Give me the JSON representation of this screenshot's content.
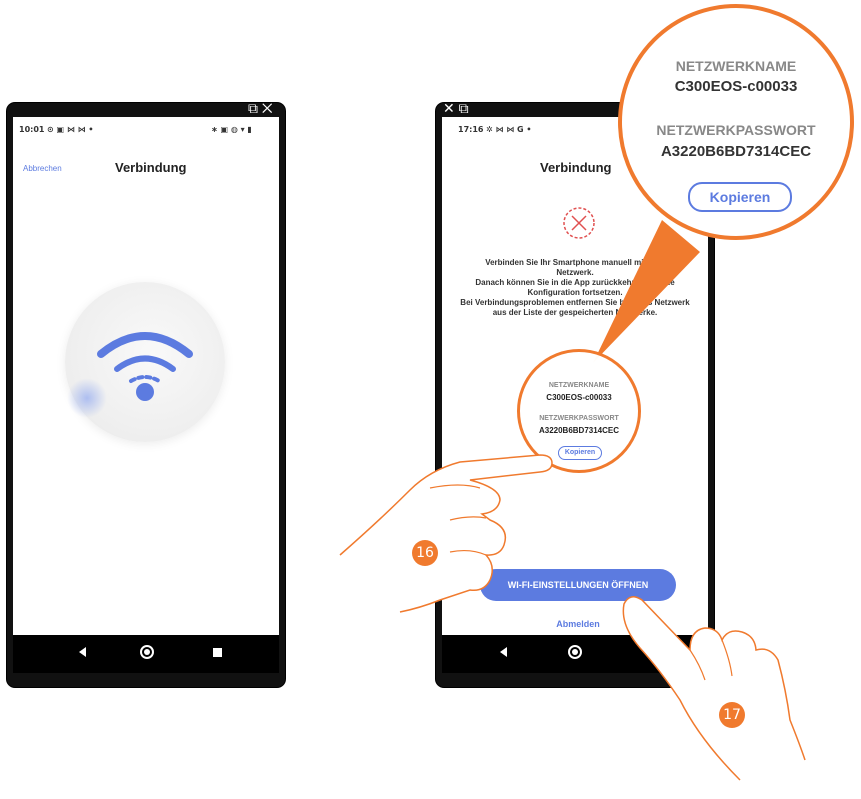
{
  "phone1": {
    "time": "10:01",
    "status_icons_left": "⊙ ▣ ⋈ ⋈ •",
    "status_icons_right": "∗ ▣ ◍ ▾ ▮",
    "top_icons": "⧉ ✕",
    "cancel_label": "Abbrechen",
    "title": "Verbindung"
  },
  "phone2": {
    "top_icons": "✕ ⧉",
    "time": "17:16",
    "status_icons_left": "✲ ⋈ ⋈ G •",
    "title": "Verbindung",
    "message_lines": [
      "Verbinden Sie Ihr Smartphone manuell mit dem",
      "Netzwerk.",
      "Danach können Sie in die App zurückkehren und die",
      "Konfiguration fortsetzen.",
      "Bei Verbindungsproblemen entfernen Sie bitte das Netzwerk",
      "aus der Liste der gespeicherten Netzwerke."
    ],
    "network_name_label": "NETZWERKNAME",
    "network_name": "C300EOS-c00033",
    "password_label": "NETZWERKPASSWORT",
    "password": "A3220B6BD7314CEC",
    "copy_label": "Kopieren",
    "wifi_settings_button": "WI-FI-EINSTELLUNGEN ÖFFNEN",
    "logout_label": "Abmelden"
  },
  "zoom": {
    "network_name_label": "NETZWERKNAME",
    "network_name": "C300EOS-c00033",
    "password_label": "NETZWERKPASSWORT",
    "password": "A3220B6BD7314CEC",
    "copy_label": "Kopieren"
  },
  "steps": {
    "step16": "16",
    "step17": "17"
  },
  "colors": {
    "accent": "#5c7be0",
    "callout": "#f07a2e",
    "error": "#e05050"
  }
}
